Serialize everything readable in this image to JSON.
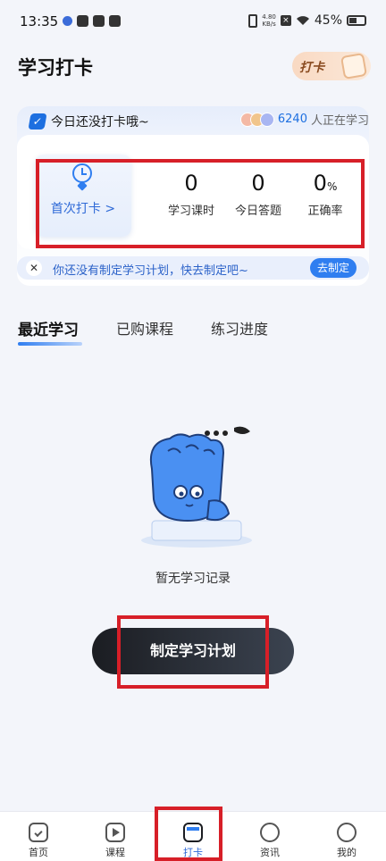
{
  "status_bar": {
    "time": "13:35",
    "net_speed_value": "4.80",
    "net_speed_unit": "KB/s",
    "battery": "45%"
  },
  "header": {
    "title": "学习打卡",
    "badge_label": "打卡"
  },
  "card": {
    "status_text": "今日还没打卡哦~",
    "online_count": "6240",
    "online_suffix": "人正在学习",
    "first_checkin_label": "首次打卡 >",
    "stats": [
      {
        "value": "0",
        "unit": "",
        "label": "学习课时"
      },
      {
        "value": "0",
        "unit": "",
        "label": "今日答题"
      },
      {
        "value": "0",
        "unit": "%",
        "label": "正确率"
      }
    ],
    "banner_text": "你还没有制定学习计划，快去制定吧~",
    "banner_button": "去制定"
  },
  "tabs": [
    {
      "label": "最近学习",
      "active": true
    },
    {
      "label": "已购课程",
      "active": false
    },
    {
      "label": "练习进度",
      "active": false
    }
  ],
  "empty_state": {
    "text": "暂无学习记录",
    "button_label": "制定学习计划"
  },
  "bottom_nav": [
    {
      "label": "首页",
      "icon": "home-icon"
    },
    {
      "label": "课程",
      "icon": "play-icon"
    },
    {
      "label": "打卡",
      "icon": "calendar-icon",
      "active": true
    },
    {
      "label": "资讯",
      "icon": "compass-icon"
    },
    {
      "label": "我的",
      "icon": "profile-icon"
    }
  ],
  "colors": {
    "accent": "#2f7ef0",
    "highlight": "#d71f28",
    "dark_button": "#1b1d22"
  }
}
